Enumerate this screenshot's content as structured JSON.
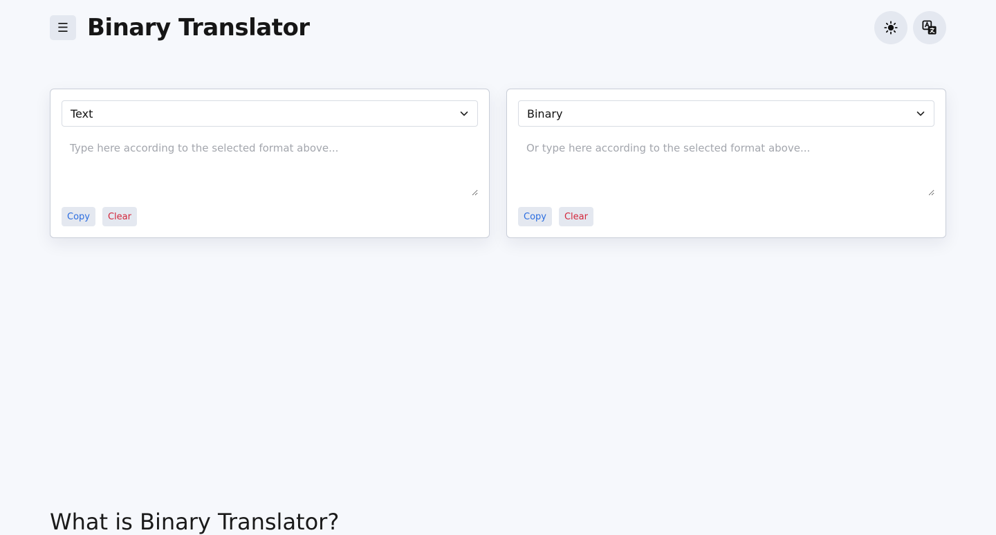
{
  "header": {
    "menu_icon": "☰",
    "title": "Binary Translator",
    "theme_icon": "sun-icon",
    "language_icon": "translate-icon"
  },
  "panels": [
    {
      "format": "Text",
      "placeholder": "Type here according to the selected format above...",
      "copy_label": "Copy",
      "clear_label": "Clear"
    },
    {
      "format": "Binary",
      "placeholder": "Or type here according to the selected format above...",
      "copy_label": "Copy",
      "clear_label": "Clear"
    }
  ],
  "section": {
    "heading": "What is Binary Translator?"
  },
  "colors": {
    "background": "#f6f8fc",
    "copy": "#2b6de0",
    "clear": "#d3263a",
    "button_bg": "#e4e8f0"
  }
}
